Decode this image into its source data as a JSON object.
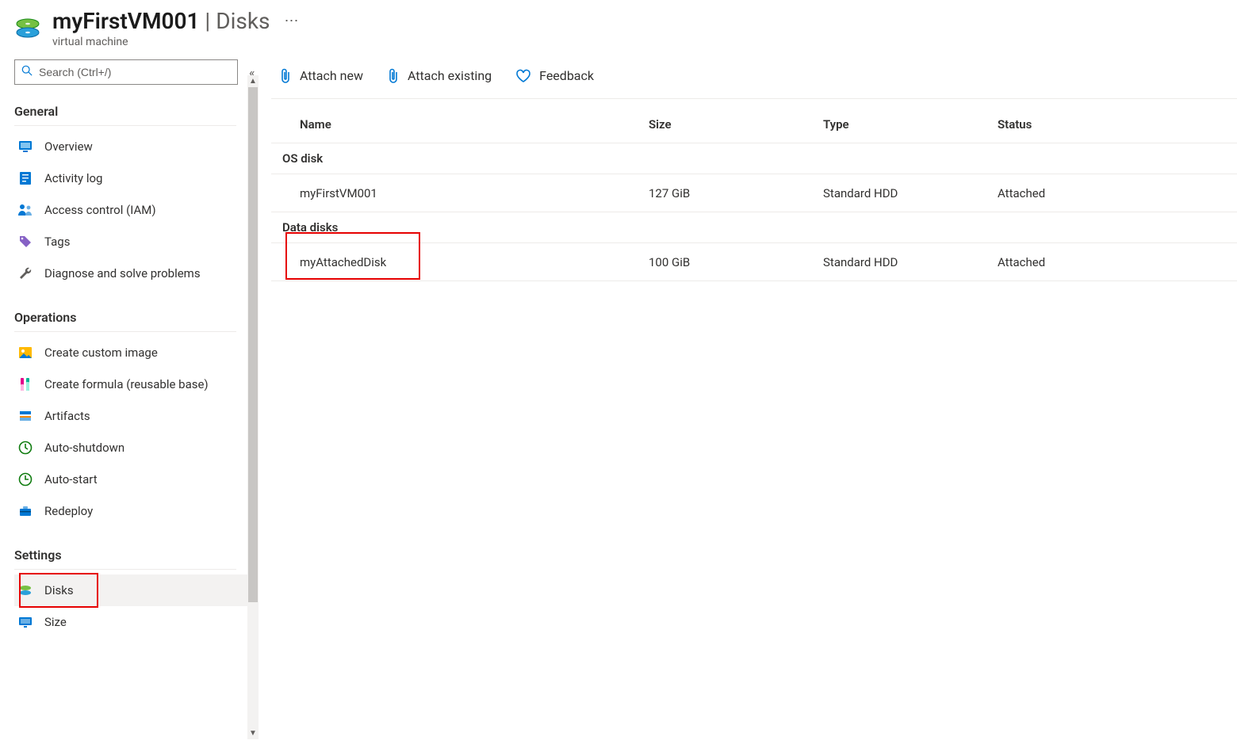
{
  "header": {
    "resource_name": "myFirstVM001",
    "section": "Disks",
    "subtitle": "virtual machine"
  },
  "sidebar": {
    "search_placeholder": "Search (Ctrl+/)",
    "sections": [
      {
        "title": "General",
        "items": [
          {
            "key": "overview",
            "label": "Overview"
          },
          {
            "key": "activity-log",
            "label": "Activity log"
          },
          {
            "key": "access-control",
            "label": "Access control (IAM)"
          },
          {
            "key": "tags",
            "label": "Tags"
          },
          {
            "key": "diagnose",
            "label": "Diagnose and solve problems"
          }
        ]
      },
      {
        "title": "Operations",
        "items": [
          {
            "key": "create-custom-image",
            "label": "Create custom image"
          },
          {
            "key": "create-formula",
            "label": "Create formula (reusable base)"
          },
          {
            "key": "artifacts",
            "label": "Artifacts"
          },
          {
            "key": "auto-shutdown",
            "label": "Auto-shutdown"
          },
          {
            "key": "auto-start",
            "label": "Auto-start"
          },
          {
            "key": "redeploy",
            "label": "Redeploy"
          }
        ]
      },
      {
        "title": "Settings",
        "items": [
          {
            "key": "disks",
            "label": "Disks",
            "selected": true,
            "highlighted": true
          },
          {
            "key": "size",
            "label": "Size"
          }
        ]
      }
    ]
  },
  "toolbar": {
    "attach_new": "Attach new",
    "attach_existing": "Attach existing",
    "feedback": "Feedback"
  },
  "table": {
    "columns": {
      "name": "Name",
      "size": "Size",
      "type": "Type",
      "status": "Status"
    },
    "groups": [
      {
        "label": "OS disk",
        "rows": [
          {
            "name": "myFirstVM001",
            "size": "127 GiB",
            "type": "Standard HDD",
            "status": "Attached"
          }
        ]
      },
      {
        "label": "Data disks",
        "rows": [
          {
            "name": "myAttachedDisk",
            "size": "100 GiB",
            "type": "Standard HDD",
            "status": "Attached",
            "highlighted": true
          }
        ]
      }
    ]
  }
}
